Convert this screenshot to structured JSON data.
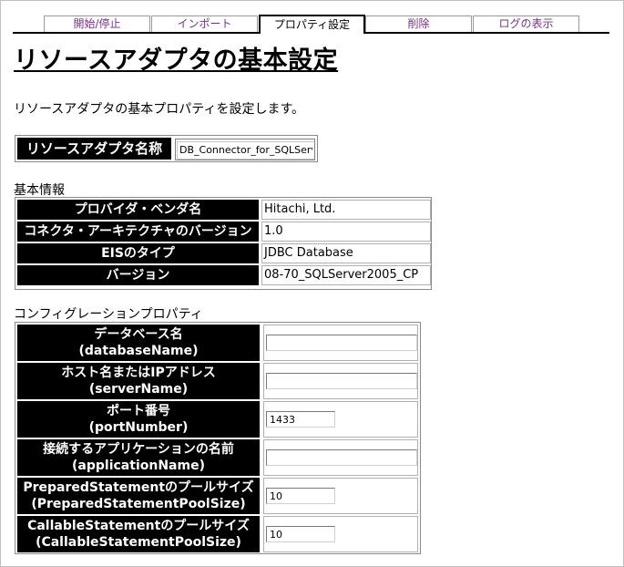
{
  "tabs": [
    {
      "label": "開始/停止",
      "active": false
    },
    {
      "label": "インポート",
      "active": false
    },
    {
      "label": "プロパティ設定",
      "active": true
    },
    {
      "label": "削除",
      "active": false
    },
    {
      "label": "ログの表示",
      "active": false
    }
  ],
  "page": {
    "title": "リソースアダプタの基本設定",
    "description": "リソースアダプタの基本プロパティを設定します。"
  },
  "adapter_name": {
    "label": "リソースアダプタ名称",
    "value": "DB_Connector_for_SQLServer"
  },
  "basic_info": {
    "heading": "基本情報",
    "rows": [
      {
        "label": "プロバイダ・ベンダ名",
        "value": "Hitachi, Ltd."
      },
      {
        "label": "コネクタ・アーキテクチャのバージョン",
        "value": "1.0"
      },
      {
        "label": "EISのタイプ",
        "value": "JDBC Database"
      },
      {
        "label": "バージョン",
        "value": "08-70_SQLServer2005_CP"
      }
    ]
  },
  "config": {
    "heading": "コンフィグレーションプロパティ",
    "rows": [
      {
        "label": "データベース名",
        "prop": "(databaseName)",
        "value": ""
      },
      {
        "label": "ホスト名またはIPアドレス",
        "prop": "(serverName)",
        "value": ""
      },
      {
        "label": "ポート番号",
        "prop": "(portNumber)",
        "value": "1433"
      },
      {
        "label": "接続するアプリケーションの名前",
        "prop": "(applicationName)",
        "value": ""
      },
      {
        "label": "PreparedStatementのプールサイズ",
        "prop": "(PreparedStatementPoolSize)",
        "value": "10"
      },
      {
        "label": "CallableStatementのプールサイズ",
        "prop": "(CallableStatementPoolSize)",
        "value": "10"
      }
    ]
  },
  "colors": {
    "tab_link": "#7b2d8e",
    "label_bg": "#000000",
    "label_text": "#ffffff"
  }
}
